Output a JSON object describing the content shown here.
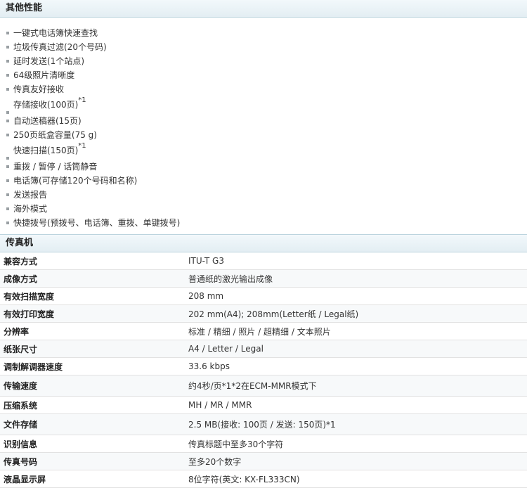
{
  "other": {
    "title": "其他性能",
    "features": [
      {
        "text": "一键式电话簿快速查找",
        "sup": ""
      },
      {
        "text": "垃圾传真过滤(20个号码)",
        "sup": ""
      },
      {
        "text": "延时发送(1个站点)",
        "sup": ""
      },
      {
        "text": "64级照片清晰度",
        "sup": ""
      },
      {
        "text": "传真友好接收",
        "sup": ""
      },
      {
        "text": "存储接收(100页)",
        "sup": "*1"
      },
      {
        "text": "自动送稿器(15页)",
        "sup": ""
      },
      {
        "text": "250页纸盒容量(75 g)",
        "sup": ""
      },
      {
        "text": "快速扫描(150页)",
        "sup": "*1"
      },
      {
        "text": "重拨 / 暂停 / 话筒静音",
        "sup": ""
      },
      {
        "text": "电话簿(可存储120个号码和名称)",
        "sup": ""
      },
      {
        "text": "发送报告",
        "sup": ""
      },
      {
        "text": "海外模式",
        "sup": ""
      },
      {
        "text": "快捷拨号(预拨号、电话簿、重拨、单键拨号)",
        "sup": ""
      }
    ]
  },
  "fax": {
    "title": "传真机",
    "rows": [
      {
        "key": "兼容方式",
        "value": "ITU-T G3"
      },
      {
        "key": "成像方式",
        "value": "普通纸的激光输出成像"
      },
      {
        "key": "有效扫描宽度",
        "value": "208 mm"
      },
      {
        "key": "有效打印宽度",
        "value": "202 mm(A4); 208mm(Letter纸 / Legal纸)"
      },
      {
        "key": "分辨率",
        "value": "标准 / 精细 / 照片 / 超精细 / 文本照片"
      },
      {
        "key": "纸张尺寸",
        "value": "A4 / Letter / Legal"
      },
      {
        "key": "调制解调器速度",
        "value": "33.6 kbps"
      },
      {
        "key": "传输速度",
        "value": "约4秒/页*1*2在ECM-MMR模式下"
      },
      {
        "key": "压缩系统",
        "value": "MH / MR / MMR"
      },
      {
        "key": "文件存储",
        "value": "2.5 MB(接收: 100页 / 发送: 150页)*1"
      },
      {
        "key": "识别信息",
        "value": "传真标题中至多30个字符"
      },
      {
        "key": "传真号码",
        "value": "至多20个数字"
      },
      {
        "key": "液晶显示屏",
        "value": "8位字符(英文: KX-FL333CN)"
      }
    ]
  }
}
